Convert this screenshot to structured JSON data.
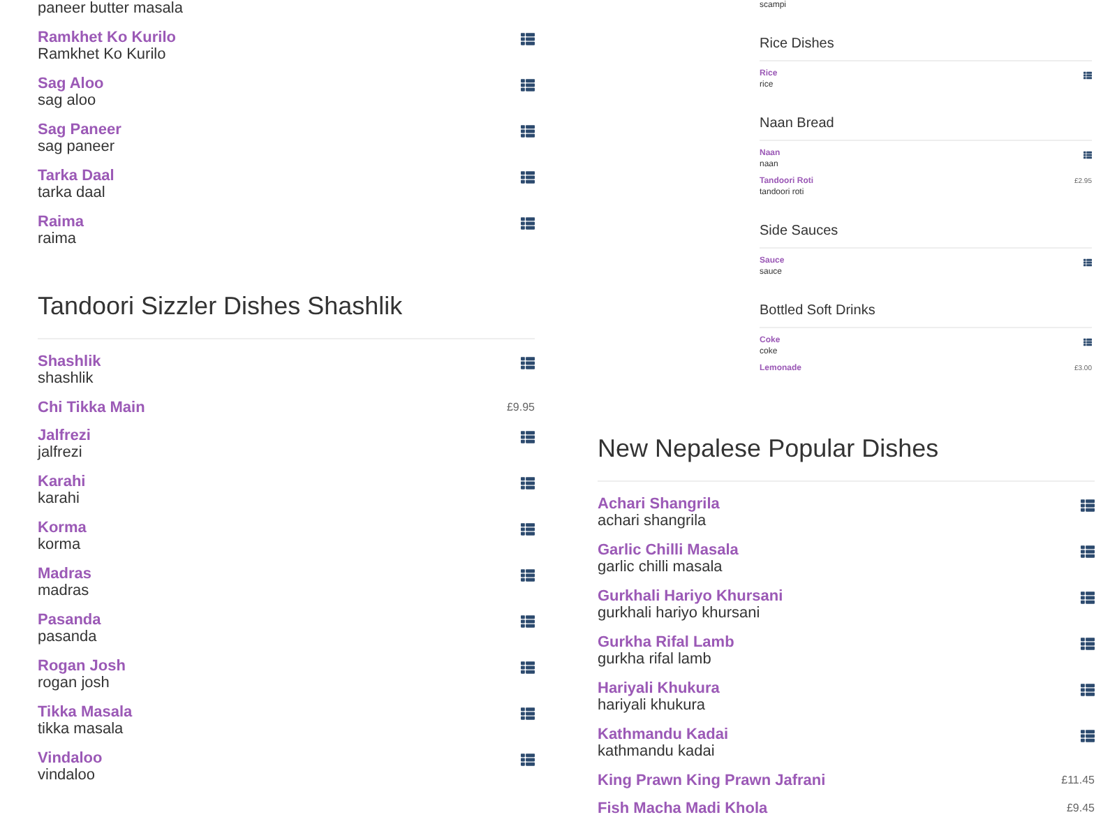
{
  "left_column": {
    "sections": [
      {
        "items": [
          {
            "kind": "fragment",
            "description": "paneer butter masala"
          },
          {
            "kind": "info",
            "name": "Ramkhet Ko Kurilo",
            "description": "Ramkhet Ko Kurilo"
          },
          {
            "kind": "info",
            "name": "Sag Aloo",
            "description": "sag aloo"
          },
          {
            "kind": "info",
            "name": "Sag Paneer",
            "description": "sag paneer"
          },
          {
            "kind": "info",
            "name": "Tarka Daal",
            "description": "tarka daal"
          },
          {
            "kind": "info",
            "name": "Raima",
            "description": "raima"
          }
        ]
      },
      {
        "heading": "Tandoori Sizzler Dishes Shashlik",
        "items": [
          {
            "kind": "info",
            "name": "Shashlik",
            "description": "shashlik"
          },
          {
            "kind": "priced",
            "name": "Chi Tikka Main",
            "price": "£9.95"
          },
          {
            "kind": "info",
            "name": "Jalfrezi",
            "description": "jalfrezi"
          },
          {
            "kind": "info",
            "name": "Karahi",
            "description": "karahi"
          },
          {
            "kind": "info",
            "name": "Korma",
            "description": "korma"
          },
          {
            "kind": "info",
            "name": "Madras",
            "description": "madras"
          },
          {
            "kind": "info",
            "name": "Pasanda",
            "description": "pasanda"
          },
          {
            "kind": "info",
            "name": "Rogan Josh",
            "description": "rogan josh"
          },
          {
            "kind": "info",
            "name": "Tikka Masala",
            "description": "tikka masala"
          },
          {
            "kind": "info",
            "name": "Vindaloo",
            "description": "vindaloo"
          }
        ]
      }
    ]
  },
  "preview_panel": {
    "sections": [
      {
        "items": [
          {
            "kind": "fragment",
            "description": "scampi"
          }
        ]
      },
      {
        "heading": "Rice Dishes",
        "items": [
          {
            "kind": "info",
            "name": "Rice",
            "description": "rice"
          }
        ]
      },
      {
        "heading": "Naan Bread",
        "items": [
          {
            "kind": "info",
            "name": "Naan",
            "description": "naan"
          },
          {
            "kind": "priced",
            "name": "Tandoori Roti",
            "description": "tandoori roti",
            "price": "£2.95"
          }
        ]
      },
      {
        "heading": "Side Sauces",
        "items": [
          {
            "kind": "info",
            "name": "Sauce",
            "description": "sauce"
          }
        ]
      },
      {
        "heading": "Bottled Soft Drinks",
        "items": [
          {
            "kind": "info",
            "name": "Coke",
            "description": "coke"
          },
          {
            "kind": "priced",
            "name": "Lemonade",
            "price": "£3.00"
          }
        ]
      }
    ]
  },
  "right_column": {
    "sections": [
      {
        "heading": "New Nepalese Popular Dishes",
        "items": [
          {
            "kind": "info",
            "name": "Achari Shangrila",
            "description": "achari shangrila"
          },
          {
            "kind": "info",
            "name": "Garlic Chilli Masala",
            "description": "garlic chilli masala"
          },
          {
            "kind": "info",
            "name": "Gurkhali Hariyo Khursani",
            "description": "gurkhali hariyo khursani"
          },
          {
            "kind": "info",
            "name": "Gurkha Rifal Lamb",
            "description": "gurkha rifal lamb"
          },
          {
            "kind": "info",
            "name": "Hariyali Khukura",
            "description": "hariyali khukura"
          },
          {
            "kind": "info",
            "name": "Kathmandu Kadai",
            "description": "kathmandu kadai"
          },
          {
            "kind": "priced",
            "name": "King Prawn King Prawn Jafrani",
            "price": "£11.45"
          },
          {
            "kind": "priced",
            "name": "Fish Macha Madi Khola",
            "price": "£9.45"
          }
        ]
      }
    ]
  }
}
